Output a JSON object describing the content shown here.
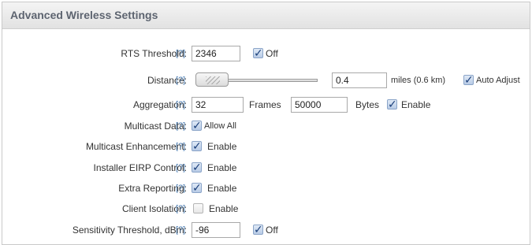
{
  "panel": {
    "title": "Advanced Wireless Settings"
  },
  "help_text": "[?]",
  "rows": {
    "rts": {
      "label": "RTS Threshold:",
      "value": "2346",
      "checkbox_label": "Off",
      "checked": true
    },
    "distance": {
      "label": "Distance:",
      "value": "0.4",
      "units": "miles (0.6 km)",
      "checkbox_label": "Auto Adjust",
      "checked": true
    },
    "aggregation": {
      "label": "Aggregation:",
      "frames_value": "32",
      "frames_label": "Frames",
      "bytes_value": "50000",
      "bytes_label": "Bytes",
      "checkbox_label": "Enable",
      "checked": true
    },
    "multicast_data": {
      "label": "Multicast Data:",
      "checkbox_label": "Allow All",
      "checked": true
    },
    "multicast_enh": {
      "label": "Multicast Enhancement:",
      "checkbox_label": "Enable",
      "checked": true
    },
    "installer_eirp": {
      "label": "Installer EIRP Control:",
      "checkbox_label": "Enable",
      "checked": true
    },
    "extra_reporting": {
      "label": "Extra Reporting:",
      "checkbox_label": "Enable",
      "checked": true
    },
    "client_isolation": {
      "label": "Client Isolation:",
      "checkbox_label": "Enable",
      "checked": false
    },
    "sensitivity": {
      "label": "Sensitivity Threshold, dBm:",
      "value": "-96",
      "checkbox_label": "Off",
      "checked": true
    }
  }
}
